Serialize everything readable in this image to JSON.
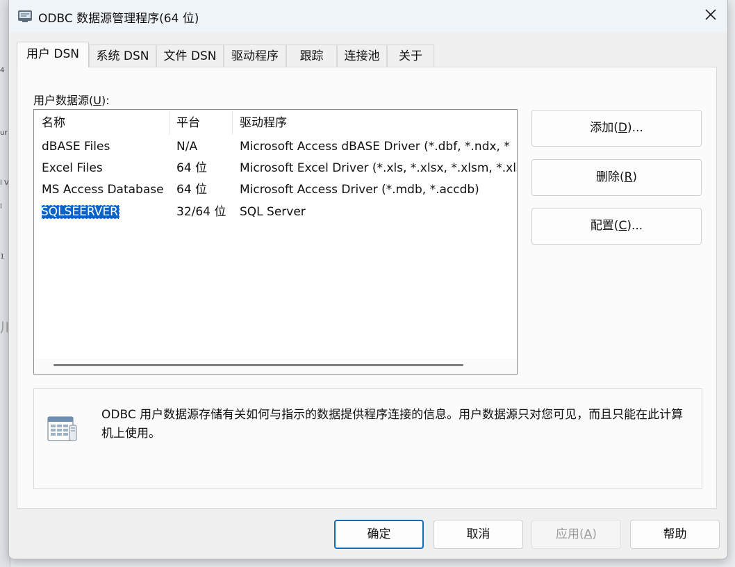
{
  "window": {
    "title": "ODBC 数据源管理程序(64 位)"
  },
  "tabs": [
    {
      "label": "用户 DSN",
      "active": true
    },
    {
      "label": "系统 DSN"
    },
    {
      "label": "文件 DSN"
    },
    {
      "label": "驱动程序"
    },
    {
      "label": "跟踪"
    },
    {
      "label": "连接池"
    },
    {
      "label": "关于"
    }
  ],
  "datasources": {
    "label_prefix": "用户数据源(",
    "label_key": "U",
    "label_suffix": "):",
    "columns": [
      "名称",
      "平台",
      "驱动程序"
    ],
    "rows": [
      {
        "name": "dBASE Files",
        "platform": "N/A",
        "driver": "Microsoft Access dBASE Driver (*.dbf, *.ndx, *"
      },
      {
        "name": "Excel Files",
        "platform": "64 位",
        "driver": "Microsoft Excel Driver (*.xls, *.xlsx, *.xlsm, *.xls"
      },
      {
        "name": "MS Access Database",
        "platform": "64 位",
        "driver": "Microsoft Access Driver (*.mdb, *.accdb)"
      },
      {
        "name": "SQLSEERVER",
        "platform": "32/64 位",
        "driver": "SQL Server",
        "selected": true
      }
    ]
  },
  "side_buttons": {
    "add": {
      "text": "添加(",
      "key": "D",
      "suffix": ")..."
    },
    "remove": {
      "text": "删除(",
      "key": "R",
      "suffix": ")"
    },
    "configure": {
      "text": "配置(",
      "key": "C",
      "suffix": ")..."
    }
  },
  "info": {
    "text": "ODBC 用户数据源存储有关如何与指示的数据提供程序连接的信息。用户数据源只对您可见，而且只能在此计算机上使用。"
  },
  "bottom_buttons": {
    "ok": "确定",
    "cancel": "取消",
    "apply_text": "应用(",
    "apply_key": "A",
    "apply_suffix": ")",
    "help": "帮助"
  },
  "background_fragments": [
    "4",
    "ur",
    "l V",
    "l",
    "1",
    "川日"
  ],
  "colors": {
    "selection": "#0a64c8",
    "default_button_border": "#0f6cbd",
    "titlebar": "#eef4f7"
  },
  "icons": {
    "app": "odbc-app-icon",
    "close": "close-icon",
    "info": "datasource-info-icon"
  }
}
